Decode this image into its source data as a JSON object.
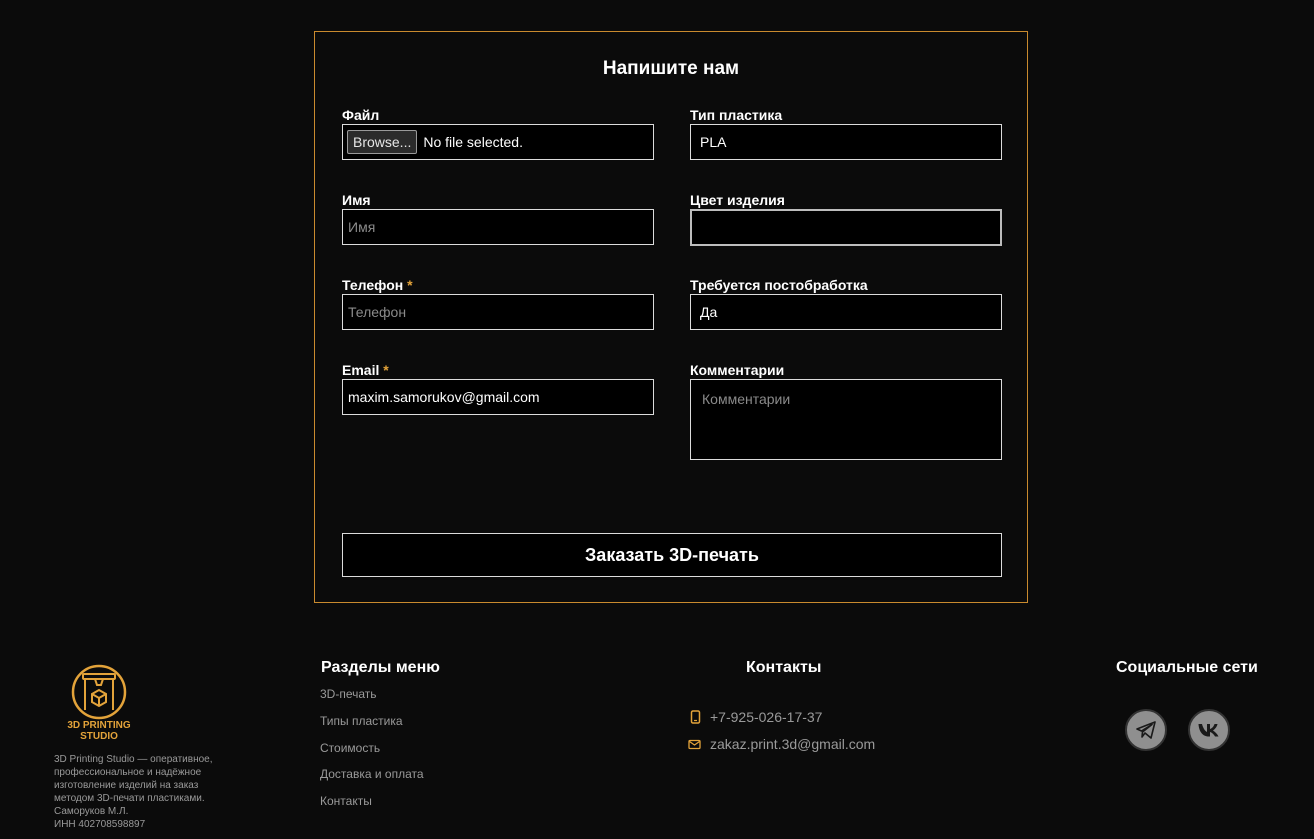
{
  "form": {
    "title": "Напишите нам",
    "file": {
      "label": "Файл",
      "button": "Browse...",
      "status": "No file selected."
    },
    "plastic": {
      "label": "Тип пластика",
      "value": "PLA"
    },
    "name": {
      "label": "Имя",
      "placeholder": "Имя"
    },
    "color": {
      "label": "Цвет изделия",
      "value": ""
    },
    "phone": {
      "label": "Телефон",
      "required_mark": "*",
      "placeholder": "Телефон"
    },
    "postprocess": {
      "label": "Требуется постобработка",
      "value": "Да"
    },
    "email": {
      "label": "Email",
      "required_mark": "*",
      "value": "maxim.samorukov@gmail.com"
    },
    "comments": {
      "label": "Комментарии",
      "placeholder": "Комментарии"
    },
    "submit_label": "Заказать 3D-печать"
  },
  "footer": {
    "logo_text_line1": "3D PRINTING",
    "logo_text_line2": "STUDIO",
    "about_lines": [
      "3D Printing Studio — оперативное,",
      "профессиональное и надёжное",
      "изготовление изделий на заказ",
      "методом 3D-печати пластиками.",
      "Саморуков М.Л.",
      "ИНН 402708598897"
    ],
    "menu_heading": "Разделы меню",
    "menu_items": [
      "3D-печать",
      "Типы пластика",
      "Стоимость",
      "Доставка и оплата",
      "Контакты"
    ],
    "contacts_heading": "Контакты",
    "phone": "+7-925-026-17-37",
    "email": "zakaz.print.3d@gmail.com",
    "social_heading": "Социальные сети",
    "social_icons": [
      "telegram-icon",
      "vk-icon"
    ]
  },
  "colors": {
    "accent": "#e3a33a",
    "border": "#c98a2e",
    "background": "#0b0b0b"
  }
}
